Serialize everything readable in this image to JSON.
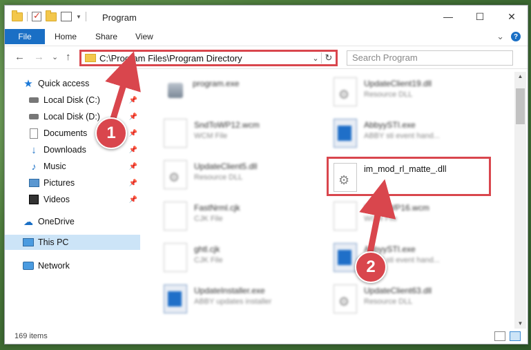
{
  "window": {
    "title": "Program",
    "minimize_glyph": "—",
    "maximize_glyph": "☐",
    "close_glyph": "✕"
  },
  "ribbon": {
    "tabs": [
      "File",
      "Home",
      "Share",
      "View"
    ],
    "expand_glyph": "⌄",
    "help_glyph": "?"
  },
  "nav": {
    "back_glyph": "←",
    "forward_glyph": "→",
    "recent_glyph": "⌄",
    "up_glyph": "↑"
  },
  "address": {
    "path": "C:\\Program Files\\Program Directory",
    "dropdown_glyph": "⌄",
    "refresh_glyph": "↻"
  },
  "search": {
    "placeholder": "Search Program"
  },
  "sidebar": {
    "items": [
      {
        "label": "Quick access",
        "icon": "star-icon"
      },
      {
        "label": "Local Disk (C:)",
        "icon": "disk-icon",
        "pinned": true
      },
      {
        "label": "Local Disk (D:)",
        "icon": "disk-icon",
        "pinned": true
      },
      {
        "label": "Documents",
        "icon": "documents-icon",
        "pinned": true
      },
      {
        "label": "Downloads",
        "icon": "download-icon",
        "pinned": true
      },
      {
        "label": "Music",
        "icon": "music-icon",
        "pinned": true
      },
      {
        "label": "Pictures",
        "icon": "pictures-icon",
        "pinned": true
      },
      {
        "label": "Videos",
        "icon": "videos-icon",
        "pinned": true
      },
      {
        "label": "OneDrive",
        "icon": "cloud-icon"
      },
      {
        "label": "This PC",
        "icon": "pc-icon",
        "selected": true
      },
      {
        "label": "Network",
        "icon": "network-icon"
      }
    ],
    "pin_glyph": "📌"
  },
  "files": [
    {
      "name": "program.exe",
      "desc": "",
      "icon": "exe"
    },
    {
      "name": "UpdateClient19.dll",
      "desc": "Resource DLL",
      "icon": "gear"
    },
    {
      "name": "SndToWP12.wcm",
      "desc": "WCM File",
      "icon": "blank"
    },
    {
      "name": "AbbyySTI.exe",
      "desc": "ABBY sti event hand...",
      "icon": "app"
    },
    {
      "name": "UpdateClient5.dll",
      "desc": "Resource DLL",
      "icon": "gear"
    },
    {
      "name": "im_mod_rl_matte_.dll",
      "desc": "",
      "icon": "gear",
      "highlighted": true
    },
    {
      "name": "FastNrml.cjk",
      "desc": "CJK File",
      "icon": "blank"
    },
    {
      "name": "SndToWP16.wcm",
      "desc": "WCM File",
      "icon": "blank"
    },
    {
      "name": "ghtl.cjk",
      "desc": "CJK File",
      "icon": "blank"
    },
    {
      "name": "AbbyySTI.exe",
      "desc": "ABBY sti event hand...",
      "icon": "app"
    },
    {
      "name": "UpdateInstaller.exe",
      "desc": "ABBY updates installer",
      "icon": "app"
    },
    {
      "name": "UpdateClient63.dll",
      "desc": "Resource DLL",
      "icon": "gear"
    }
  ],
  "status": {
    "item_count": "169 items"
  },
  "annotations": {
    "step1": "1",
    "step2": "2"
  },
  "colors": {
    "accent": "#1a6fc5",
    "highlight": "#d9464d",
    "selected": "#cce4f7"
  }
}
